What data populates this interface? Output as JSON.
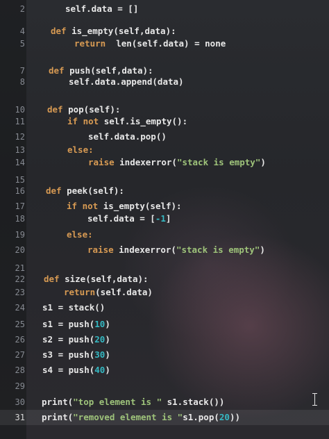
{
  "editor": {
    "lines": [
      {
        "n": "2",
        "indent": 94,
        "segs": [
          [
            "self.data = []",
            ""
          ]
        ]
      },
      {
        "n": "4",
        "indent": 73,
        "segs": [
          [
            "def ",
            "kw"
          ],
          [
            "is_empty(self,data):",
            ""
          ]
        ]
      },
      {
        "n": "5",
        "indent": 107,
        "segs": [
          [
            "return ",
            "kw"
          ],
          [
            " len(self.data) = none",
            ""
          ]
        ]
      },
      {
        "n": "7",
        "indent": 70,
        "segs": [
          [
            "def ",
            "kw"
          ],
          [
            "push(self,data):",
            ""
          ]
        ]
      },
      {
        "n": "8",
        "indent": 99,
        "segs": [
          [
            "self.data.append(data)",
            ""
          ]
        ]
      },
      {
        "n": "10",
        "indent": 68,
        "segs": [
          [
            "def ",
            "kw"
          ],
          [
            "pop(self):",
            ""
          ]
        ]
      },
      {
        "n": "11",
        "indent": 97,
        "segs": [
          [
            "if not ",
            "kw"
          ],
          [
            "self.is_empty():",
            ""
          ]
        ]
      },
      {
        "n": "12",
        "indent": 127,
        "segs": [
          [
            "self.data.pop()",
            ""
          ]
        ]
      },
      {
        "n": "13",
        "indent": 97,
        "segs": [
          [
            "else:",
            "kw"
          ]
        ]
      },
      {
        "n": "14",
        "indent": 127,
        "segs": [
          [
            "raise ",
            "kw"
          ],
          [
            "indexerror(",
            ""
          ],
          [
            "\"stack is empty\"",
            "str"
          ],
          [
            ")",
            ""
          ]
        ]
      },
      {
        "n": "15",
        "indent": 66,
        "segs": []
      },
      {
        "n": "16",
        "indent": 66,
        "segs": [
          [
            "def ",
            "kw"
          ],
          [
            "peek(self):",
            ""
          ]
        ]
      },
      {
        "n": "17",
        "indent": 96,
        "segs": [
          [
            "if not ",
            "kw"
          ],
          [
            "is_empty(self):",
            ""
          ]
        ]
      },
      {
        "n": "18",
        "indent": 126,
        "segs": [
          [
            "self.data = [",
            ""
          ],
          [
            "-1",
            "num"
          ],
          [
            "]",
            ""
          ]
        ]
      },
      {
        "n": "19",
        "indent": 96,
        "segs": [
          [
            "else:",
            "kw"
          ]
        ]
      },
      {
        "n": "20",
        "indent": 126,
        "segs": [
          [
            "raise ",
            "kw"
          ],
          [
            "indexerror(",
            ""
          ],
          [
            "\"stack is empty\"",
            "str"
          ],
          [
            ")",
            ""
          ]
        ]
      },
      {
        "n": "21",
        "indent": 63,
        "segs": []
      },
      {
        "n": "22",
        "indent": 63,
        "segs": [
          [
            "def ",
            "kw"
          ],
          [
            "size(self,data):",
            ""
          ]
        ]
      },
      {
        "n": "23",
        "indent": 92,
        "segs": [
          [
            "return",
            "kw"
          ],
          [
            "(self.data)",
            ""
          ]
        ]
      },
      {
        "n": "24",
        "indent": 61,
        "segs": [
          [
            "s1 = stack()",
            ""
          ]
        ]
      },
      {
        "n": "25",
        "indent": 61,
        "segs": [
          [
            "s1 = push(",
            ""
          ],
          [
            "10",
            "num"
          ],
          [
            ")",
            ""
          ]
        ]
      },
      {
        "n": "26",
        "indent": 61,
        "segs": [
          [
            "s2 = push(",
            ""
          ],
          [
            "20",
            "num"
          ],
          [
            ")",
            ""
          ]
        ]
      },
      {
        "n": "27",
        "indent": 61,
        "segs": [
          [
            "s3 = push(",
            ""
          ],
          [
            "30",
            "num"
          ],
          [
            ")",
            ""
          ]
        ]
      },
      {
        "n": "28",
        "indent": 61,
        "segs": [
          [
            "s4 = push(",
            ""
          ],
          [
            "40",
            "num"
          ],
          [
            ")",
            ""
          ]
        ]
      },
      {
        "n": "29",
        "indent": 60,
        "segs": []
      },
      {
        "n": "30",
        "indent": 60,
        "segs": [
          [
            "print(",
            ""
          ],
          [
            "\"top element is \"",
            "str"
          ],
          [
            " s1.stack())",
            ""
          ]
        ]
      },
      {
        "n": "31",
        "indent": 60,
        "current": true,
        "segs": [
          [
            "print(",
            ""
          ],
          [
            "\"removed element is \"",
            "str"
          ],
          [
            "s1.pop(",
            ""
          ],
          [
            "20",
            "num"
          ],
          [
            "))",
            ""
          ]
        ]
      }
    ]
  },
  "colors": {
    "keyword": "#d79a53",
    "string": "#9ec37a",
    "number": "#35b8c2",
    "text": "#e8e8e8",
    "line_number": "#868a92"
  },
  "cursor": {
    "icon": "text-cursor-icon"
  }
}
